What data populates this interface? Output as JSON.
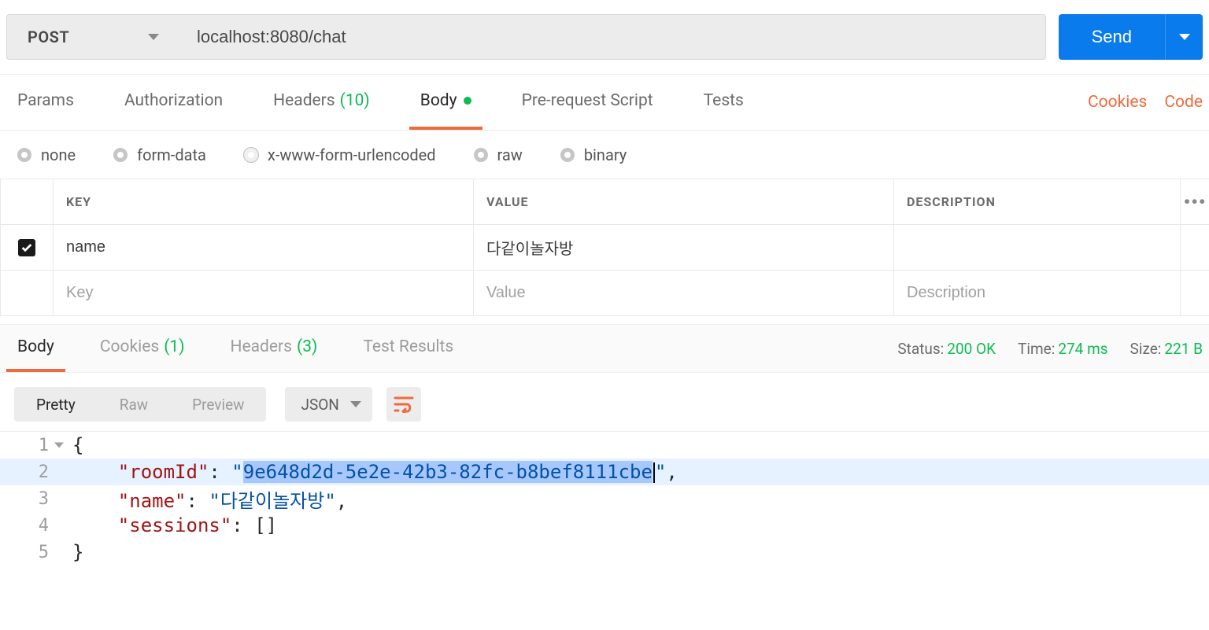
{
  "request": {
    "method": "POST",
    "url": "localhost:8080/chat",
    "sendLabel": "Send"
  },
  "reqTabs": {
    "params": "Params",
    "authorization": "Authorization",
    "headers": "Headers",
    "headersCount": "(10)",
    "body": "Body",
    "preRequest": "Pre-request Script",
    "tests": "Tests",
    "cookies": "Cookies",
    "code": "Code"
  },
  "bodyTypes": {
    "none": "none",
    "formData": "form-data",
    "urlencoded": "x-www-form-urlencoded",
    "raw": "raw",
    "binary": "binary"
  },
  "kv": {
    "headerKey": "KEY",
    "headerValue": "VALUE",
    "headerDesc": "DESCRIPTION",
    "rows": [
      {
        "key": "name",
        "value": "다같이놀자방",
        "desc": ""
      }
    ],
    "placeholderKey": "Key",
    "placeholderValue": "Value",
    "placeholderDesc": "Description"
  },
  "respTabs": {
    "body": "Body",
    "cookies": "Cookies",
    "cookiesCount": "(1)",
    "headers": "Headers",
    "headersCount": "(3)",
    "testResults": "Test Results"
  },
  "respMeta": {
    "statusLabel": "Status:",
    "statusValue": "200 OK",
    "timeLabel": "Time:",
    "timeValue": "274 ms",
    "sizeLabel": "Size:",
    "sizeValue": "221 B"
  },
  "viewBar": {
    "pretty": "Pretty",
    "raw": "Raw",
    "preview": "Preview",
    "format": "JSON"
  },
  "response": {
    "lines": {
      "l1": "{",
      "l2_key": "\"roomId\"",
      "l2_val": "9e648d2d-5e2e-42b3-82fc-b8bef8111cbe",
      "l3_key": "\"name\"",
      "l3_val": "\"다같이놀자방\"",
      "l4_key": "\"sessions\"",
      "l4_val": "[]",
      "l5": "}"
    }
  }
}
